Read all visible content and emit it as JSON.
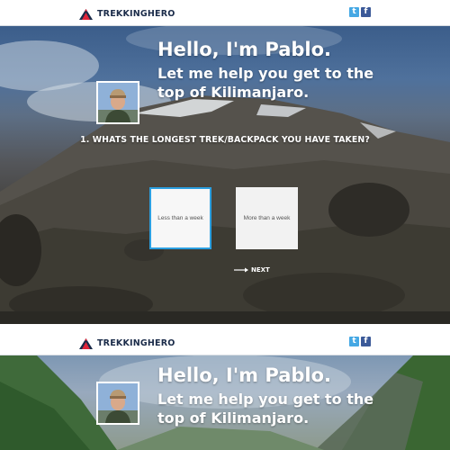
{
  "brand": {
    "name": "TREKKINGHERO",
    "colors": {
      "navy": "#1a2b49",
      "red": "#e0253a",
      "accent": "#2b9fe0"
    }
  },
  "social": [
    {
      "name": "twitter-icon",
      "glyph": "t"
    },
    {
      "name": "facebook-icon",
      "glyph": "f"
    }
  ],
  "hero": {
    "greeting": "Hello, I'm Pablo.",
    "subtitle": "Let me help you get to the top of Kilimanjaro."
  },
  "quiz": {
    "question": "1. WHATS THE LONGEST TREK/BACKPACK YOU HAVE TAKEN?",
    "options": [
      {
        "label": "Less than a week",
        "selected": true
      },
      {
        "label": "More than a week",
        "selected": false
      }
    ],
    "next_label": "NEXT"
  }
}
